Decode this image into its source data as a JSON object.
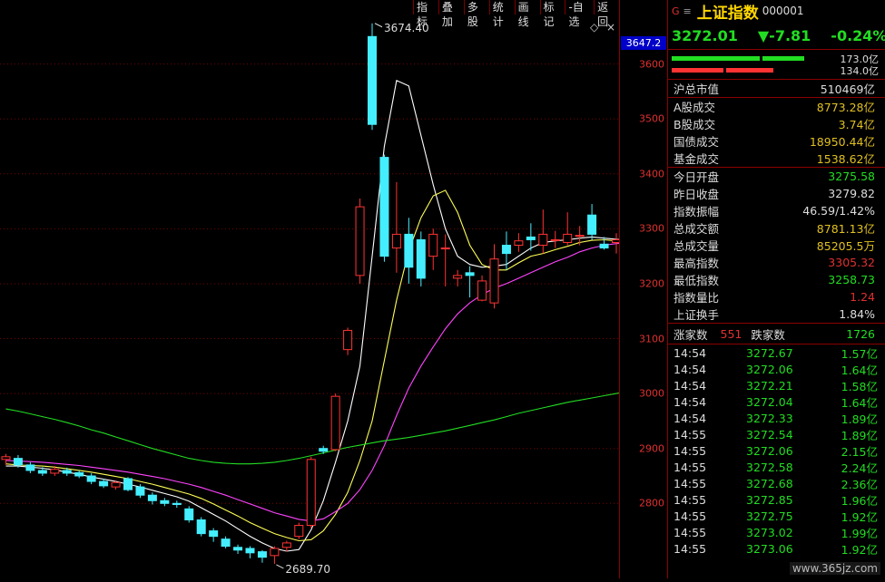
{
  "toolbar": [
    "指标",
    "叠加",
    "多股",
    "统计",
    "画线",
    "标记",
    "-自选",
    "返回"
  ],
  "axis": {
    "current_price": "3647.2",
    "ticks": [
      {
        "label": "3600",
        "value": 3600
      },
      {
        "label": "3500",
        "value": 3500
      },
      {
        "label": "3400",
        "value": 3400
      },
      {
        "label": "3300",
        "value": 3300
      },
      {
        "label": "3200",
        "value": 3200
      },
      {
        "label": "3100",
        "value": 3100
      },
      {
        "label": "3000",
        "value": 3000
      },
      {
        "label": "2900",
        "value": 2900
      },
      {
        "label": "2800",
        "value": 2800
      }
    ]
  },
  "chart_data": {
    "type": "candlestick",
    "ylim": [
      2680,
      3700
    ],
    "annotations": {
      "high_label": "3674.40",
      "low_label": "2689.70"
    },
    "colors": {
      "up": "#ff3333",
      "down": "#44eeff",
      "ma5": "#ffffff",
      "ma10": "#ffff55",
      "ma20": "#ff44ff",
      "ma60": "#22dd22"
    },
    "candles": [
      [
        2880,
        2885,
        2870,
        2890
      ],
      [
        2882,
        2870,
        2865,
        2888
      ],
      [
        2870,
        2860,
        2855,
        2875
      ],
      [
        2860,
        2855,
        2850,
        2866
      ],
      [
        2855,
        2862,
        2850,
        2868
      ],
      [
        2860,
        2855,
        2850,
        2865
      ],
      [
        2856,
        2850,
        2846,
        2860
      ],
      [
        2850,
        2840,
        2835,
        2855
      ],
      [
        2840,
        2832,
        2828,
        2845
      ],
      [
        2830,
        2838,
        2825,
        2842
      ],
      [
        2845,
        2825,
        2822,
        2848
      ],
      [
        2830,
        2815,
        2810,
        2835
      ],
      [
        2815,
        2805,
        2798,
        2820
      ],
      [
        2805,
        2800,
        2795,
        2810
      ],
      [
        2800,
        2798,
        2792,
        2805
      ],
      [
        2790,
        2770,
        2765,
        2795
      ],
      [
        2770,
        2745,
        2740,
        2775
      ],
      [
        2750,
        2740,
        2730,
        2755
      ],
      [
        2735,
        2722,
        2718,
        2740
      ],
      [
        2720,
        2715,
        2708,
        2725
      ],
      [
        2718,
        2710,
        2700,
        2722
      ],
      [
        2712,
        2702,
        2692,
        2715
      ],
      [
        2705,
        2718,
        2690,
        2722
      ],
      [
        2720,
        2728,
        2712,
        2732
      ],
      [
        2740,
        2760,
        2735,
        2765
      ],
      [
        2760,
        2880,
        2755,
        2885
      ],
      [
        2900,
        2895,
        2890,
        2905
      ],
      [
        2898,
        2995,
        2895,
        3000
      ],
      [
        3080,
        3115,
        3070,
        3120
      ],
      [
        3215,
        3340,
        3200,
        3355
      ],
      [
        3650,
        3490,
        3480,
        3674
      ],
      [
        3430,
        3250,
        3240,
        3435
      ],
      [
        3265,
        3290,
        3220,
        3385
      ],
      [
        3290,
        3230,
        3200,
        3320
      ],
      [
        3280,
        3210,
        3195,
        3295
      ],
      [
        3250,
        3290,
        3225,
        3300
      ],
      [
        3265,
        3265,
        3195,
        3290
      ],
      [
        3210,
        3215,
        3195,
        3225
      ],
      [
        3220,
        3215,
        3175,
        3232
      ],
      [
        3170,
        3205,
        3168,
        3215
      ],
      [
        3165,
        3245,
        3155,
        3272
      ],
      [
        3270,
        3255,
        3225,
        3295
      ],
      [
        3270,
        3278,
        3258,
        3292
      ],
      [
        3285,
        3280,
        3260,
        3310
      ],
      [
        3270,
        3290,
        3255,
        3335
      ],
      [
        3280,
        3280,
        3265,
        3296
      ],
      [
        3275,
        3290,
        3270,
        3330
      ],
      [
        3288,
        3288,
        3270,
        3305
      ],
      [
        3325,
        3290,
        3280,
        3345
      ],
      [
        3272,
        3265,
        3262,
        3285
      ],
      [
        3275,
        3280,
        3255,
        3292
      ],
      [
        3280,
        3272,
        3258,
        3305
      ]
    ],
    "series": [
      {
        "key": "ma5",
        "values": [
          2868,
          2868,
          2866,
          2864,
          2861,
          2857,
          2853,
          2848,
          2844,
          2840,
          2835,
          2830,
          2824,
          2818,
          2812,
          2804,
          2792,
          2780,
          2768,
          2754,
          2740,
          2728,
          2718,
          2713,
          2716,
          2752,
          2805,
          2875,
          2950,
          3050,
          3250,
          3450,
          3570,
          3560,
          3470,
          3380,
          3300,
          3250,
          3235,
          3230,
          3232,
          3235,
          3250,
          3265,
          3275,
          3278,
          3280,
          3283,
          3285,
          3283,
          3281,
          3280
        ]
      },
      {
        "key": "ma10",
        "values": [
          2872,
          2870,
          2869,
          2868,
          2866,
          2863,
          2860,
          2857,
          2853,
          2849,
          2845,
          2840,
          2835,
          2829,
          2823,
          2817,
          2809,
          2799,
          2788,
          2777,
          2765,
          2755,
          2745,
          2738,
          2732,
          2734,
          2750,
          2780,
          2820,
          2878,
          2950,
          3060,
          3170,
          3260,
          3320,
          3360,
          3370,
          3330,
          3270,
          3235,
          3225,
          3225,
          3238,
          3250,
          3255,
          3262,
          3268,
          3275,
          3279,
          3280,
          3278,
          3276
        ]
      },
      {
        "key": "ma20",
        "values": [
          2878,
          2877,
          2876,
          2875,
          2873,
          2871,
          2869,
          2866,
          2863,
          2860,
          2857,
          2853,
          2849,
          2845,
          2840,
          2835,
          2829,
          2822,
          2815,
          2807,
          2799,
          2791,
          2783,
          2777,
          2771,
          2768,
          2772,
          2785,
          2800,
          2825,
          2860,
          2905,
          2960,
          3010,
          3050,
          3085,
          3118,
          3145,
          3165,
          3180,
          3192,
          3200,
          3210,
          3220,
          3230,
          3240,
          3248,
          3258,
          3265,
          3270,
          3273,
          3275
        ]
      },
      {
        "key": "ma60",
        "values": [
          2972,
          2968,
          2963,
          2958,
          2953,
          2947,
          2941,
          2934,
          2928,
          2921,
          2914,
          2907,
          2900,
          2894,
          2888,
          2882,
          2878,
          2875,
          2873,
          2872,
          2872,
          2873,
          2875,
          2878,
          2882,
          2887,
          2892,
          2897,
          2902,
          2906,
          2910,
          2914,
          2917,
          2920,
          2924,
          2928,
          2932,
          2937,
          2942,
          2947,
          2952,
          2958,
          2964,
          2969,
          2974,
          2979,
          2984,
          2988,
          2992,
          2996,
          3000,
          3004
        ]
      }
    ]
  },
  "panel": {
    "g_mark": "G",
    "menu_icon": "≡",
    "name": "上证指数",
    "code": "000001",
    "price": "3272.01",
    "change": "▼-7.81",
    "change_pct": "-0.24%",
    "bar_up": "173.0亿",
    "bar_down": "134.0亿",
    "market": [
      {
        "label": "沪总市值",
        "value": "510469亿",
        "color": "white"
      }
    ],
    "turnover": [
      {
        "label": "A股成交",
        "value": "8773.28亿",
        "color": "yellow"
      },
      {
        "label": "B股成交",
        "value": "3.74亿",
        "color": "yellow"
      },
      {
        "label": "国债成交",
        "value": "18950.44亿",
        "color": "yellow"
      },
      {
        "label": "基金成交",
        "value": "1538.62亿",
        "color": "yellow"
      }
    ],
    "stats": [
      {
        "label": "今日开盘",
        "value": "3275.58",
        "color": "green"
      },
      {
        "label": "昨日收盘",
        "value": "3279.82",
        "color": "white"
      },
      {
        "label": "指数振幅",
        "value": "46.59/1.42%",
        "color": "white"
      },
      {
        "label": "总成交额",
        "value": "8781.13亿",
        "color": "yellow"
      },
      {
        "label": "总成交量",
        "value": "85205.5万",
        "color": "yellow"
      },
      {
        "label": "最高指数",
        "value": "3305.32",
        "color": "red"
      },
      {
        "label": "最低指数",
        "value": "3258.73",
        "color": "green"
      },
      {
        "label": "指数量比",
        "value": "1.24",
        "color": "red"
      },
      {
        "label": "上证换手",
        "value": "1.84%",
        "color": "white"
      }
    ],
    "breadth": {
      "up_label": "涨家数",
      "up_value": "551",
      "down_label": "跌家数",
      "down_value": "1726"
    },
    "ticks": [
      {
        "time": "14:54",
        "price": "3272.67",
        "amount": "1.57亿"
      },
      {
        "time": "14:54",
        "price": "3272.06",
        "amount": "1.64亿"
      },
      {
        "time": "14:54",
        "price": "3272.21",
        "amount": "1.58亿"
      },
      {
        "time": "14:54",
        "price": "3272.04",
        "amount": "1.64亿"
      },
      {
        "time": "14:54",
        "price": "3272.33",
        "amount": "1.89亿"
      },
      {
        "time": "14:55",
        "price": "3272.54",
        "amount": "1.89亿"
      },
      {
        "time": "14:55",
        "price": "3272.06",
        "amount": "2.15亿"
      },
      {
        "time": "14:55",
        "price": "3272.58",
        "amount": "2.24亿"
      },
      {
        "time": "14:55",
        "price": "3272.68",
        "amount": "2.36亿"
      },
      {
        "time": "14:55",
        "price": "3272.85",
        "amount": "1.96亿"
      },
      {
        "time": "14:55",
        "price": "3272.75",
        "amount": "1.92亿"
      },
      {
        "time": "14:55",
        "price": "3273.02",
        "amount": "1.99亿"
      },
      {
        "time": "14:55",
        "price": "3273.06",
        "amount": "1.92亿"
      }
    ],
    "watermark": "www.365jz.com"
  }
}
